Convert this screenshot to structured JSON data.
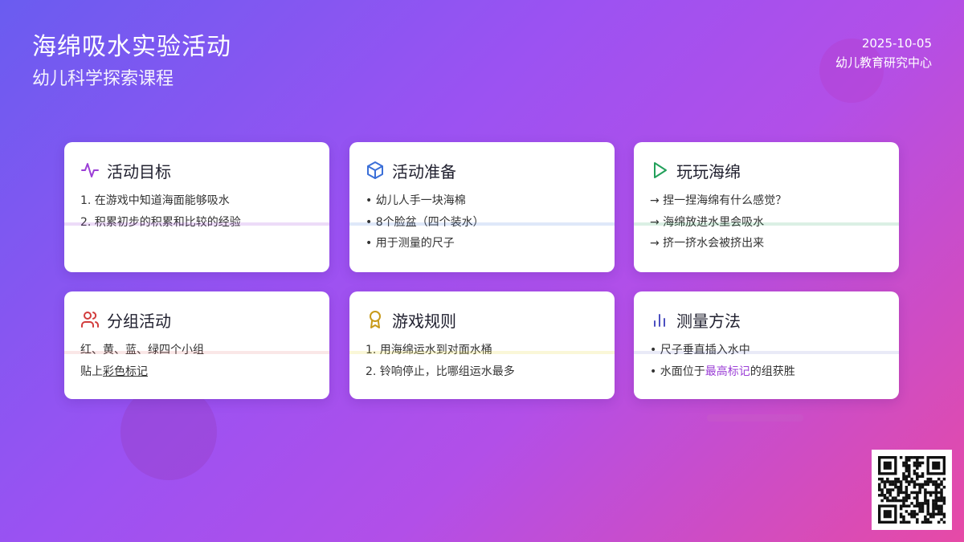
{
  "header": {
    "title": "海绵吸水实验活动",
    "subtitle": "幼儿科学探索课程",
    "date": "2025-10-05",
    "org": "幼儿教育研究中心"
  },
  "colors": {
    "purple": "#9b3fd6",
    "blue": "#3b6fd8",
    "green": "#22a05a",
    "red": "#d23c3c",
    "gold": "#c89a1a",
    "indigo": "#4b4fc0"
  },
  "cards": [
    {
      "icon": "activity-pulse-icon",
      "title": "活动目标",
      "lines": [
        "1. 在游戏中知道海面能够吸水",
        "2. 积累初步的积累和比较的经验"
      ]
    },
    {
      "icon": "cube-box-icon",
      "title": "活动准备",
      "lines": [
        "• 幼儿人手一块海棉",
        "• 8个脸盆（四个装水）",
        "• 用于测量的尺子"
      ]
    },
    {
      "icon": "play-triangle-icon",
      "title": "玩玩海绵",
      "lines": [
        "→ 捏一捏海绵有什么感觉？",
        "→ 海绵放进水里会吸水",
        "→ 挤一挤水会被挤出来"
      ]
    },
    {
      "icon": "users-group-icon",
      "title": "分组活动",
      "lines": [
        "红、黄、蓝、绿四个小组"
      ],
      "line_underlined_pre": "贴上",
      "line_underlined": "彩色标记"
    },
    {
      "icon": "award-medal-icon",
      "title": "游戏规则",
      "lines": [
        "1. 用海绵运水到对面水桶",
        "2. 铃响停止，比哪组运水最多"
      ]
    },
    {
      "icon": "bar-chart-icon",
      "title": "测量方法",
      "lines": [
        "• 尺子垂直插入水中"
      ],
      "line_hl_pre": "• 水面位于",
      "line_hl": "最高标记",
      "line_hl_post": "的组获胜"
    }
  ]
}
